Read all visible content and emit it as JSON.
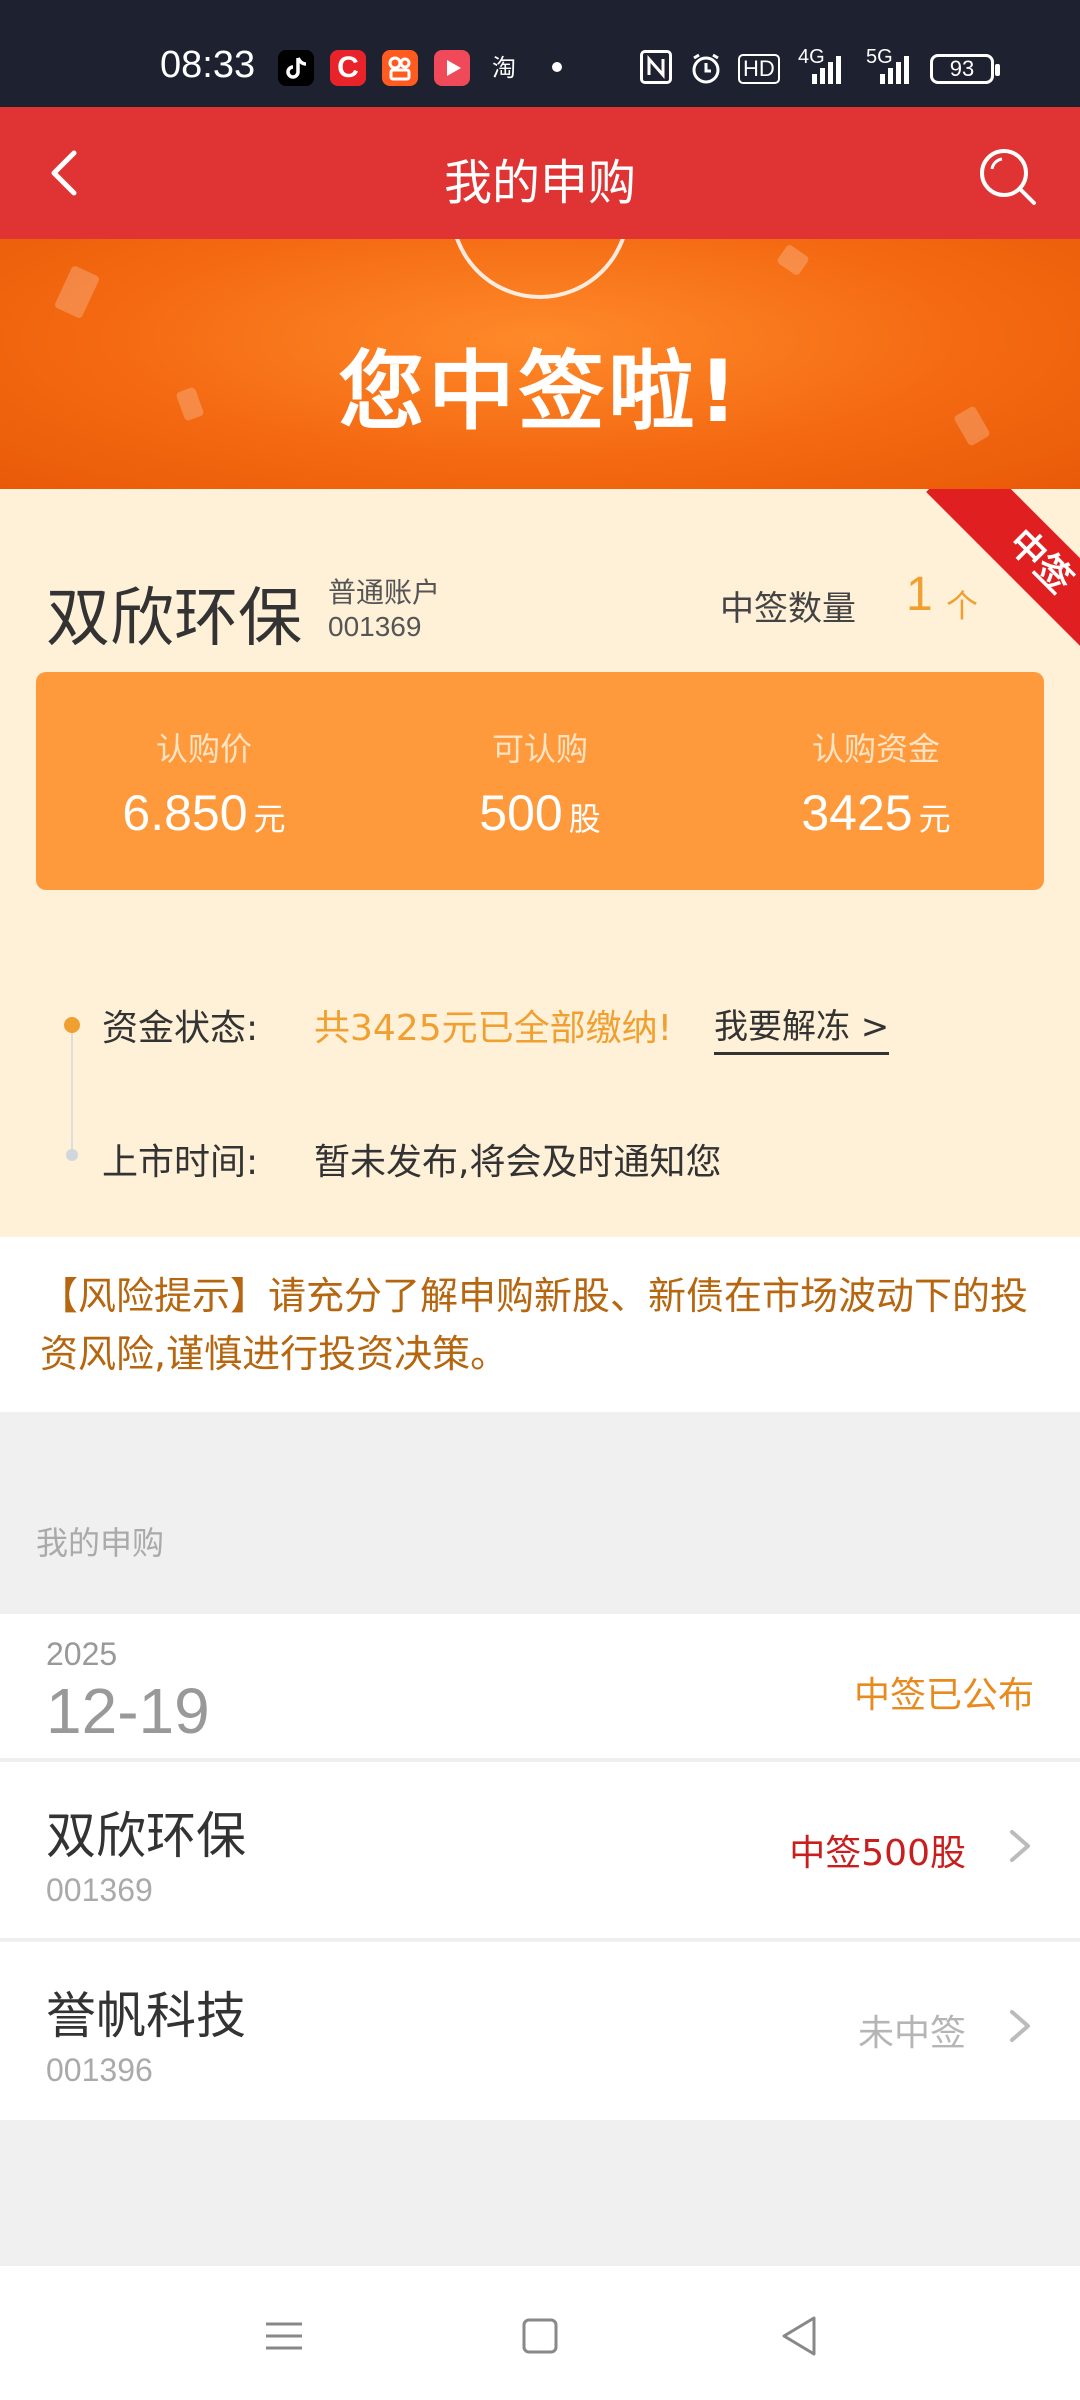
{
  "status_bar": {
    "time": "08:33",
    "network1": "4G",
    "network2": "5G",
    "hd_label": "HD",
    "battery": "93"
  },
  "header": {
    "title": "我的申购",
    "back_icon": "chevron-left-icon",
    "search_icon": "search-icon"
  },
  "banner": {
    "text": "您中签啦!"
  },
  "result": {
    "ribbon": "中签",
    "stock_name": "双欣环保",
    "account_type": "普通账户",
    "stock_code": "001369",
    "win_label": "中签数量",
    "win_count": "1",
    "win_unit": "个",
    "summary": [
      {
        "label": "认购价",
        "value": "6.850",
        "unit": "元"
      },
      {
        "label": "可认购",
        "value": "500",
        "unit": "股"
      },
      {
        "label": "认购资金",
        "value": "3425",
        "unit": "元"
      }
    ],
    "fund_status_label": "资金状态:",
    "fund_status_value": "共3425元已全部缴纳!",
    "unfreeze_link": "我要解冻 >",
    "listing_label": "上市时间:",
    "listing_value": "暂未发布,将会及时通知您"
  },
  "risk_notice": "【风险提示】请充分了解申购新股、新债在市场波动下的投资风险,谨慎进行投资决策。",
  "section_title": "我的申购",
  "list": {
    "year": "2025",
    "month_day": "12-19",
    "date_status": "中签已公布",
    "items": [
      {
        "name": "双欣环保",
        "code": "001369",
        "result": "中签500股",
        "result_color": "#c81e1e"
      },
      {
        "name": "誉帆科技",
        "code": "001396",
        "result": "未中签",
        "result_color": "#b5b5b5"
      }
    ]
  },
  "colors": {
    "header": "#e03333",
    "banner": "#f46a12",
    "result_bg": "#fff0d8",
    "card": "#ff9a3c",
    "accent": "#f0a030",
    "risk_text": "#b5660f"
  }
}
